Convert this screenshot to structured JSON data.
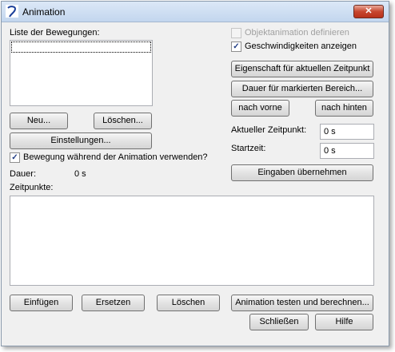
{
  "window": {
    "title": "Animation",
    "close_glyph": "✕"
  },
  "movements": {
    "label": "Liste der Bewegungen:",
    "items": []
  },
  "buttons": {
    "new": "Neu...",
    "delete_movement": "Löschen...",
    "settings": "Einstellungen...",
    "property_current": "Eigenschaft für aktuellen Zeitpunkt",
    "duration_range": "Dauer für markierten Bereich...",
    "forward": "nach vorne",
    "backward": "nach hinten",
    "apply": "Eingaben übernehmen",
    "insert": "Einfügen",
    "replace": "Ersetzen",
    "delete_time": "Löschen",
    "test": "Animation testen und berechnen...",
    "close": "Schließen",
    "help": "Hilfe"
  },
  "checkboxes": {
    "use_movement": {
      "label": "Bewegung während der Animation verwenden?",
      "checked": true
    },
    "define_object": {
      "label": "Objektanimation definieren",
      "checked": false,
      "enabled": false
    },
    "show_speeds": {
      "label": "Geschwindigkeiten anzeigen",
      "checked": true
    }
  },
  "check_glyph": "✓",
  "duration": {
    "label": "Dauer:",
    "value": "0 s"
  },
  "timepoints": {
    "label": "Zeitpunkte:",
    "items": []
  },
  "current_time": {
    "label": "Aktueller Zeitpunkt:",
    "value": "0 s"
  },
  "start_time": {
    "label": "Startzeit:",
    "value": "0 s"
  }
}
